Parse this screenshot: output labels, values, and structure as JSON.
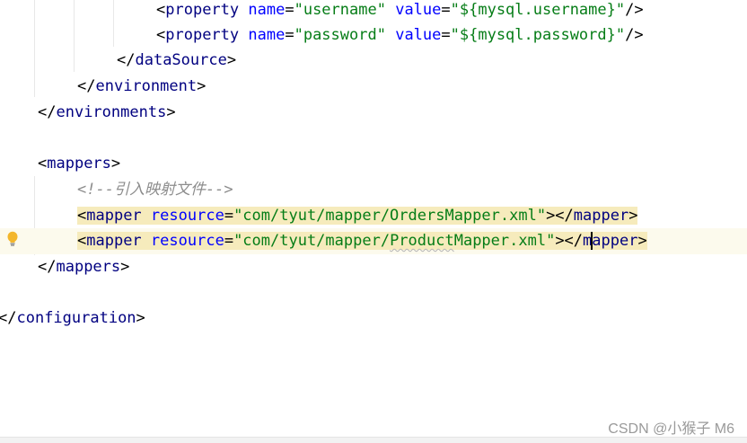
{
  "editor": {
    "lines": {
      "l1": {
        "open": "<",
        "tag": "property",
        "sp1": " ",
        "attr1": "name",
        "eq1": "=",
        "val1": "\"username\"",
        "sp2": " ",
        "attr2": "value",
        "eq2": "=",
        "val2": "\"${mysql.username}\"",
        "close": "/>"
      },
      "l2": {
        "open": "<",
        "tag": "property",
        "sp1": " ",
        "attr1": "name",
        "eq1": "=",
        "val1": "\"password\"",
        "sp2": " ",
        "attr2": "value",
        "eq2": "=",
        "val2": "\"${mysql.password}\"",
        "close": "/>"
      },
      "l3": {
        "open": "</",
        "tag": "dataSource",
        "close": ">"
      },
      "l4": {
        "open": "</",
        "tag": "environment",
        "close": ">"
      },
      "l5": {
        "open": "</",
        "tag": "environments",
        "close": ">"
      },
      "l6": {
        "open": "<",
        "tag": "mappers",
        "close": ">"
      },
      "l7": {
        "comment": "<!--引入映射文件-->"
      },
      "l8": {
        "open": "<",
        "tag": "mapper",
        "sp": " ",
        "attr": "resource",
        "eq": "=",
        "val": "\"com/tyut/mapper/OrdersMapper.xml\"",
        "mid": "></",
        "tag2": "mapper",
        "close": ">"
      },
      "l9": {
        "open": "<",
        "tag": "mapper",
        "sp": " ",
        "attr": "resource",
        "eq": "=",
        "val_a": "\"com/tyut/mapper/",
        "val_b": "Product",
        "val_c": "Mapper.xml\"",
        "mid": "></",
        "tag2a": "m",
        "tag2b": "apper",
        "close": ">"
      },
      "l10": {
        "open": "</",
        "tag": "mappers",
        "close": ">"
      },
      "l11": {
        "open": "</",
        "tag": "configuration",
        "close": ">"
      }
    },
    "gutter_icon": "lightbulb-icon"
  },
  "watermark": "CSDN @小猴子 M6",
  "colors": {
    "tag": "#000080",
    "attribute": "#0000ff",
    "string": "#067d17",
    "comment": "#8c8c8c",
    "tag_highlight": "#f6ebbc",
    "current_line": "#fcfaed"
  }
}
